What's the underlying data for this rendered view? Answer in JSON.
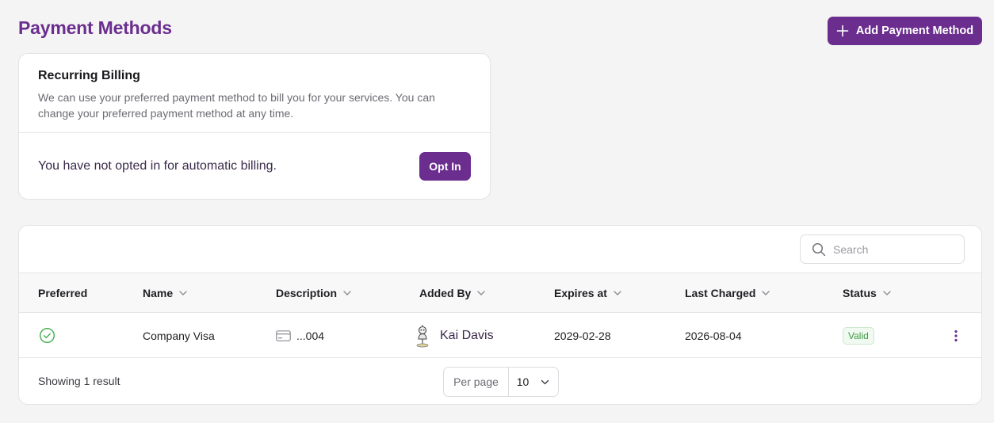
{
  "header": {
    "title": "Payment Methods",
    "add_button_label": "Add Payment Method"
  },
  "billing": {
    "title": "Recurring Billing",
    "description": "We can use your preferred payment method to bill you for your services. You can change your preferred payment method at any time.",
    "status_message": "You have not opted in for automatic billing.",
    "opt_in_label": "Opt In"
  },
  "table": {
    "search_placeholder": "Search",
    "columns": {
      "preferred": "Preferred",
      "name": "Name",
      "description": "Description",
      "added_by": "Added By",
      "expires_at": "Expires at",
      "last_charged": "Last Charged",
      "status": "Status"
    },
    "rows": [
      {
        "preferred": true,
        "name": "Company Visa",
        "description": "...004",
        "added_by": "Kai Davis",
        "expires_at": "2029-02-28",
        "last_charged": "2026-08-04",
        "status": "Valid"
      }
    ],
    "footer": {
      "result_text": "Showing 1 result",
      "per_page_label": "Per page",
      "per_page_value": "10"
    }
  },
  "icons": {
    "add": "plus-icon",
    "search": "search-icon",
    "sort": "chevron-down-icon",
    "preferred": "check-circle-icon",
    "card": "credit-card-icon",
    "avatar": "avatar",
    "more": "kebab-menu-icon"
  },
  "colors": {
    "brand": "#6b2d8e",
    "valid_text": "#3f9a45",
    "valid_bg": "#f1faf1",
    "check": "#3fae49"
  }
}
